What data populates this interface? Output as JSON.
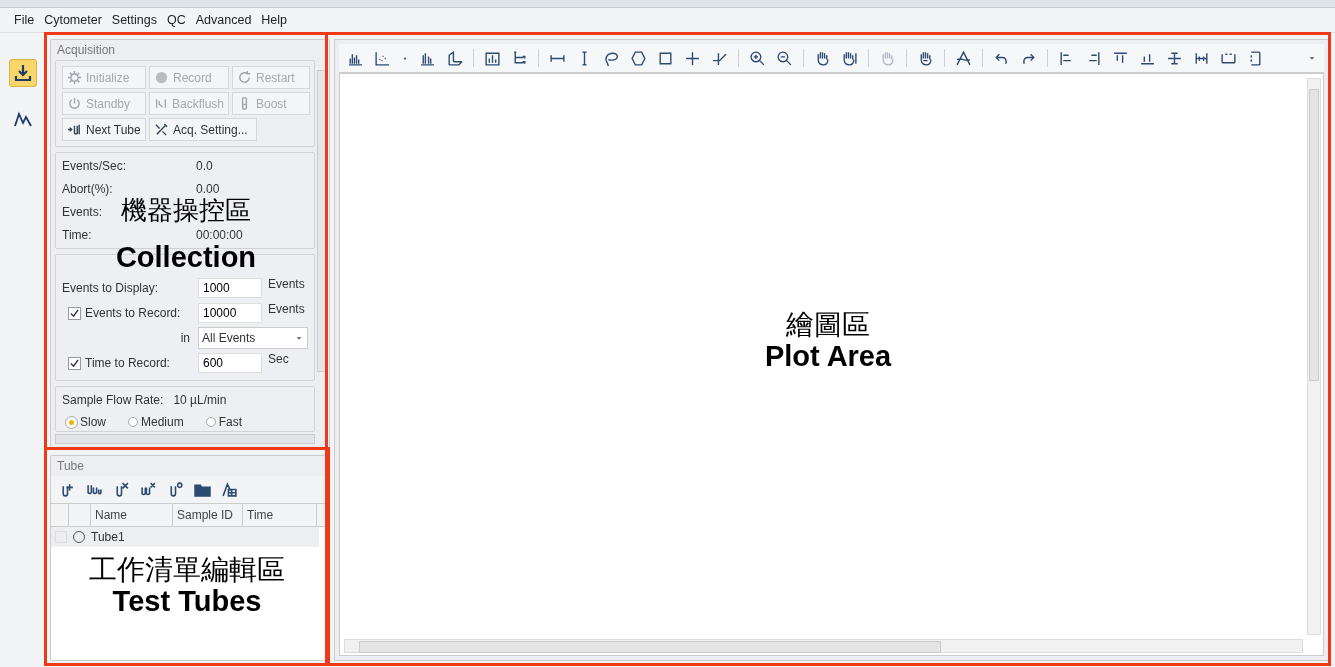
{
  "menu": [
    "File",
    "Cytometer",
    "Settings",
    "QC",
    "Advanced",
    "Help"
  ],
  "sidebar": [
    {
      "kind": "acquisition",
      "selected": true
    },
    {
      "kind": "analysis",
      "selected": false
    }
  ],
  "acquisition": {
    "title": "Acquisition",
    "buttons": [
      {
        "label": "Initialize",
        "disabled": true
      },
      {
        "label": "Record",
        "disabled": true
      },
      {
        "label": "Restart",
        "disabled": true
      },
      {
        "label": "Standby",
        "disabled": true
      },
      {
        "label": "Backflush",
        "disabled": true
      },
      {
        "label": "Boost",
        "disabled": true
      },
      {
        "label": "Next Tube",
        "disabled": false
      },
      {
        "label": "Acq. Setting...",
        "disabled": false
      }
    ],
    "stats": [
      {
        "label": "Events/Sec:",
        "value": "0.0"
      },
      {
        "label": "Abort(%):",
        "value": "0.00"
      },
      {
        "label": "Events:"
      },
      {
        "label": "Time:",
        "value": "00:00:00"
      }
    ],
    "settings": [
      {
        "kind": "field",
        "label": "Events to Display:",
        "value": "1000",
        "unit": "Events"
      },
      {
        "kind": "check",
        "label": "Events to Record:",
        "checked": true,
        "value": "10000",
        "unit": "Events"
      },
      {
        "kind": "select",
        "label": "in",
        "value": "All Events"
      },
      {
        "kind": "check",
        "label": "Time to Record:",
        "checked": true,
        "value": "600",
        "unit": "Sec"
      }
    ],
    "flow_rate": {
      "label": "Sample Flow Rate:",
      "value": "10 µL/min"
    },
    "rates": [
      {
        "label": "Slow",
        "selected": true
      },
      {
        "label": "Medium",
        "selected": false
      },
      {
        "label": "Fast",
        "selected": false
      }
    ]
  },
  "tube": {
    "title": "Tube",
    "columns": [
      "Name",
      "Sample ID",
      "Time"
    ],
    "rows": [
      {
        "name": "Tube1",
        "checked": false
      }
    ]
  },
  "annotations": [
    {
      "zh": "機器操控區",
      "en": "Collection"
    },
    {
      "zh": "繪圖區",
      "en": "Plot Area"
    },
    {
      "zh": "工作清單編輯區",
      "en": "Test Tubes"
    }
  ]
}
